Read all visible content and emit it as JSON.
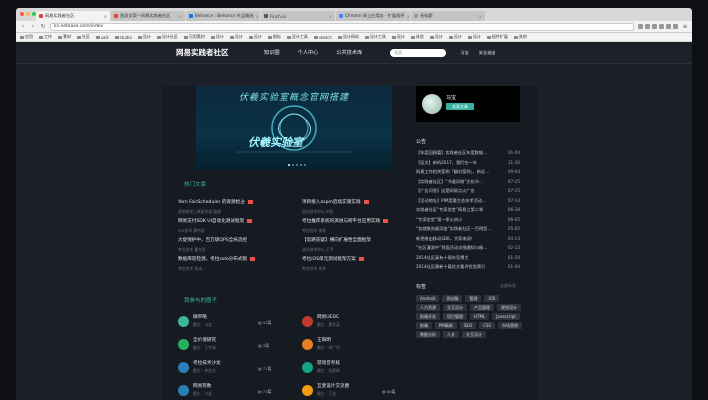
{
  "browser": {
    "tabs": [
      {
        "label": "网易实践者社区",
        "active": true
      },
      {
        "label": "直男文案—网易实践者社区",
        "active": false
      },
      {
        "label": "Behance : Behance 作品精选",
        "active": false
      },
      {
        "label": "Finch.io",
        "active": false
      },
      {
        "label": "Chrome 网上应用店 - 扩展程序",
        "active": false
      },
      {
        "label": "无标题",
        "active": false
      }
    ],
    "url": "ks.netease.com/index",
    "bookmarks": [
      "应用",
      "工作",
      "素材",
      "社区",
      "ukit",
      "studio",
      "设计",
      "设计社区",
      "可用素材",
      "设计",
      "设计",
      "设计",
      "图标",
      "设计工具",
      "sketch",
      "设计网站",
      "设计工具",
      "设计",
      "体验",
      "设计",
      "设计",
      "设计",
      "插件扩展",
      "其他"
    ]
  },
  "header": {
    "logo": "网易实践者社区",
    "nav": [
      "知识圈",
      "个人中心",
      "公共技术库"
    ],
    "search_placeholder": "搜索",
    "user_name": "马宝",
    "logout": "安全退出"
  },
  "banner": {
    "title": "伏羲实验室概念官网搭建",
    "subtitle": "伏羲实验室"
  },
  "hot": {
    "title": "热门文章",
    "articles": [
      {
        "title": "Yarn FairScheduler 的资源抢占",
        "meta": "系统研发工具研发组    路遥",
        "hot": true
      },
      {
        "title": "项目接入aspm后续实施实践",
        "meta": "测试技术中心    刘凯",
        "hot": true
      },
      {
        "title": "网易支付SDK UI自动化测试框架",
        "meta": "IOS技术    黄宗豪",
        "hot": true
      },
      {
        "title": "考拉推荐系统的演进与跨平台应用实践",
        "meta": "考拉技术    李俊",
        "hot": true
      },
      {
        "title": "大促保护中，百万级QPS全局流控",
        "meta": "考拉技术    曹东哲",
        "hot": false
      },
      {
        "title": "【思路答疑】横向扩展性全面框架",
        "meta": "测试技术中心    王平",
        "hot": false
      },
      {
        "title": "数据库巡检源，考拉solo分布式锁",
        "meta": "考拉技术    张沛",
        "hot": true
      },
      {
        "title": "考拉iOS单元测试框架方案",
        "meta": "考拉技术    李奔",
        "hot": true
      }
    ]
  },
  "circles": {
    "title": "我参与的圈子",
    "items": [
      {
        "name": "微带略",
        "meta": "圈主：马宝",
        "count": "43篇",
        "color": "#3db59a"
      },
      {
        "name": "网易UEDC",
        "meta": "圈主：黄华英",
        "count": "",
        "color": "#c0392b"
      },
      {
        "name": "全价值研究",
        "meta": "圈主：王宇清",
        "count": "3篇",
        "color": "#27ae60"
      },
      {
        "name": "王阳明",
        "meta": "圈主：周广杰",
        "count": "",
        "color": "#e67e22"
      },
      {
        "name": "考拉技术沙龙",
        "meta": "圈主：李庆文",
        "count": "71篇",
        "color": "#2c7fb8"
      },
      {
        "name": "游戏音考核",
        "meta": "圈主：张昊新",
        "count": "",
        "color": "#16a085"
      },
      {
        "name": "网易有数",
        "meta": "圈主：义斐",
        "count": "73篇",
        "color": "#2980b9"
      },
      {
        "name": "互斐设计交流圈",
        "meta": "圈主：王浩",
        "count": "68篇",
        "color": "#f39c12"
      }
    ]
  },
  "profile": {
    "name": "马宝",
    "button": "发表文章"
  },
  "announcements": {
    "title": "公告",
    "items": [
      {
        "text": "【年度回顾篇】实践者社区年度数据…",
        "date": "01-04"
      },
      {
        "text": "【征文】新的2017，我们在一年",
        "date": "11-30"
      },
      {
        "text": "网易工作相关案例「翻对案例」，新总…",
        "date": "09-04"
      },
      {
        "text": "【实践者社区】“书道风物”文化节…",
        "date": "07-25"
      },
      {
        "text": "【广告问答】这是网易点火广告",
        "date": "07-25"
      },
      {
        "text": "【活动地址】PIM度量生态技术活动…",
        "date": "07-14"
      },
      {
        "text": "实践者社区“专家坐堂”网易之第二季",
        "date": "06-28"
      },
      {
        "text": "“专家坐堂”第一季火热小",
        "date": "06-05"
      },
      {
        "text": "“包就服务器添加”实践者社区—百例型…",
        "date": "05-05"
      },
      {
        "text": "新把推出移动SDK，大家来测！",
        "date": "04-13"
      },
      {
        "text": "“社区漫游中”到面活动详细通知与概…",
        "date": "02-15"
      },
      {
        "text": "2014社区真有十周年官博主",
        "date": "01-20"
      },
      {
        "text": "2014社区最新十篇优文看评优投票行",
        "date": "01-04"
      }
    ]
  },
  "tags": {
    "title": "标签",
    "more": "全部标签",
    "items": [
      "Android",
      "测试服",
      "管理",
      "iOS",
      "人力资源",
      "交互设计",
      "产品管理",
      "视觉设计",
      "前端开发",
      "项目管理",
      "HTML",
      "Javascript",
      "前端",
      "PM精致",
      "SEO",
      "CSS",
      "市场营销",
      "数据分析",
      "人文",
      "交互设计"
    ]
  }
}
